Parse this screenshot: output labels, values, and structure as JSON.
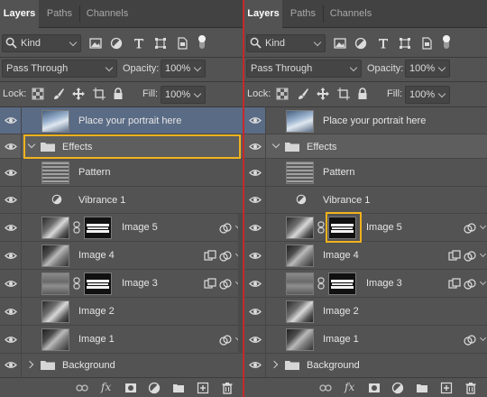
{
  "panels": [
    {
      "id": "left",
      "tabs": [
        "Layers",
        "Paths",
        "Channels"
      ],
      "filter": {
        "label": "Kind"
      },
      "blend_mode": "Pass Through",
      "opacity": {
        "label": "Opacity:",
        "value": "100%"
      },
      "lock": {
        "label": "Lock:"
      },
      "fill": {
        "label": "Fill:",
        "value": "100%"
      },
      "layers": [
        {
          "name": "Place your portrait here"
        },
        {
          "name": "Effects"
        },
        {
          "name": "Pattern"
        },
        {
          "name": "Vibrance 1"
        },
        {
          "name": "Image 5"
        },
        {
          "name": "Image 4"
        },
        {
          "name": "Image 3"
        },
        {
          "name": "Image 2"
        },
        {
          "name": "Image 1"
        },
        {
          "name": "Background"
        }
      ],
      "footer_fx": "fx"
    },
    {
      "id": "right",
      "tabs": [
        "Layers",
        "Paths",
        "Channels"
      ],
      "filter": {
        "label": "Kind"
      },
      "blend_mode": "Pass Through",
      "opacity": {
        "label": "Opacity:",
        "value": "100%"
      },
      "lock": {
        "label": "Lock:"
      },
      "fill": {
        "label": "Fill:",
        "value": "100%"
      },
      "layers": [
        {
          "name": "Place your portrait here"
        },
        {
          "name": "Effects"
        },
        {
          "name": "Pattern"
        },
        {
          "name": "Vibrance 1"
        },
        {
          "name": "Image 5"
        },
        {
          "name": "Image 4"
        },
        {
          "name": "Image 3"
        },
        {
          "name": "Image 2"
        },
        {
          "name": "Image 1"
        },
        {
          "name": "Background"
        }
      ],
      "footer_fx": "fx"
    }
  ],
  "colors": {
    "selected_row": "#5a6b85",
    "highlight": "#f2b21d",
    "divider": "#c42a2a"
  }
}
